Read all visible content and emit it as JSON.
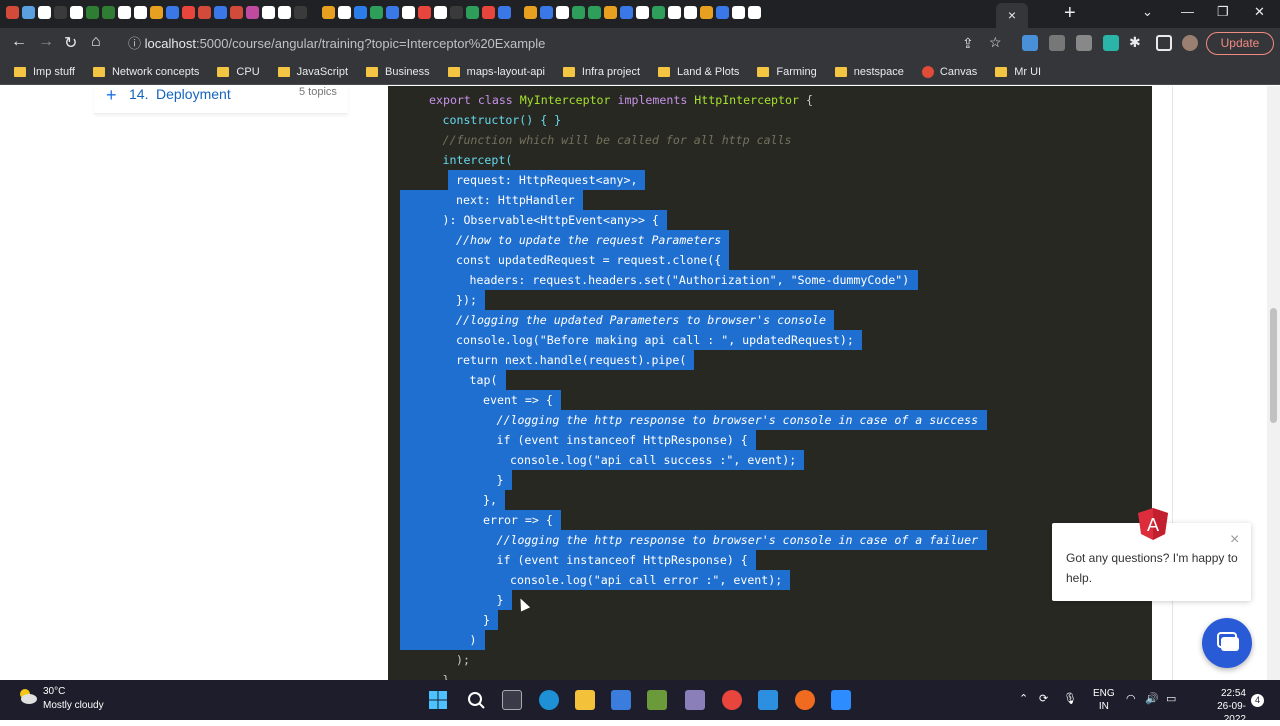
{
  "browser": {
    "url_host": "localhost",
    "url_rest": ":5000/course/angular/training?topic=Interceptor%20Example",
    "update_label": "Update",
    "bookmarks": [
      "Imp stuff",
      "Network concepts",
      "CPU",
      "JavaScript",
      "Business",
      "maps-layout-api",
      "Infra project",
      "Land & Plots",
      "Farming",
      "nestspace",
      "Canvas",
      "Mr UI"
    ]
  },
  "sidebar": {
    "item": {
      "icon": "+",
      "number": "14.",
      "title": "Deployment",
      "count": "5 topics"
    }
  },
  "code_lines": [
    {
      "indent": 0,
      "text": "export class MyInterceptor implements HttpInterceptor {",
      "kind": "class",
      "selected": false
    },
    {
      "indent": 1,
      "text": "constructor() { }",
      "kind": "fn",
      "selected": false
    },
    {
      "indent": 1,
      "text": "//function which will be called for all http calls",
      "kind": "comment",
      "selected": false
    },
    {
      "indent": 1,
      "text": "intercept(",
      "kind": "fn",
      "selected": false
    },
    {
      "indent": 2,
      "text": "request: HttpRequest<any>,",
      "kind": "plain",
      "selected": true
    },
    {
      "indent": 2,
      "text": "next: HttpHandler",
      "kind": "plain",
      "selected": true
    },
    {
      "indent": 1,
      "text": "): Observable<HttpEvent<any>> {",
      "kind": "plain",
      "selected": true
    },
    {
      "indent": 2,
      "text": "//how to update the request Parameters",
      "kind": "comment",
      "selected": true
    },
    {
      "indent": 2,
      "text": "const updatedRequest = request.clone({",
      "kind": "plain",
      "selected": true
    },
    {
      "indent": 3,
      "text": "headers: request.headers.set(\"Authorization\", \"Some-dummyCode\")",
      "kind": "plain",
      "selected": true
    },
    {
      "indent": 2,
      "text": "});",
      "kind": "plain",
      "selected": true
    },
    {
      "indent": 2,
      "text": "//logging the updated Parameters to browser's console",
      "kind": "comment",
      "selected": true
    },
    {
      "indent": 2,
      "text": "console.log(\"Before making api call : \", updatedRequest);",
      "kind": "plain",
      "selected": true
    },
    {
      "indent": 2,
      "text": "return next.handle(request).pipe(",
      "kind": "plain",
      "selected": true
    },
    {
      "indent": 3,
      "text": "tap(",
      "kind": "plain",
      "selected": true
    },
    {
      "indent": 4,
      "text": "event => {",
      "kind": "plain",
      "selected": true
    },
    {
      "indent": 5,
      "text": "//logging the http response to browser's console in case of a success",
      "kind": "comment",
      "selected": true
    },
    {
      "indent": 5,
      "text": "if (event instanceof HttpResponse) {",
      "kind": "plain",
      "selected": true
    },
    {
      "indent": 6,
      "text": "console.log(\"api call success :\", event);",
      "kind": "plain",
      "selected": true
    },
    {
      "indent": 5,
      "text": "}",
      "kind": "plain",
      "selected": true
    },
    {
      "indent": 4,
      "text": "},",
      "kind": "plain",
      "selected": true
    },
    {
      "indent": 4,
      "text": "error => {",
      "kind": "plain",
      "selected": true
    },
    {
      "indent": 5,
      "text": "//logging the http response to browser's console in case of a failuer",
      "kind": "comment",
      "selected": true
    },
    {
      "indent": 5,
      "text": "if (event instanceof HttpResponse) {",
      "kind": "plain",
      "selected": true
    },
    {
      "indent": 6,
      "text": "console.log(\"api call error :\", event);",
      "kind": "plain",
      "selected": true
    },
    {
      "indent": 5,
      "text": "}",
      "kind": "plain",
      "selected": true
    },
    {
      "indent": 4,
      "text": "}",
      "kind": "plain",
      "selected": true
    },
    {
      "indent": 3,
      "text": ")",
      "kind": "plain",
      "selected": true
    },
    {
      "indent": 2,
      "text": ");",
      "kind": "plain",
      "selected": false
    },
    {
      "indent": 1,
      "text": "}",
      "kind": "plain",
      "selected": false
    }
  ],
  "chat": {
    "message": "Got any questions? I'm happy to help.",
    "close_icon": "×"
  },
  "taskbar": {
    "temperature": "30°C",
    "weather": "Mostly cloudy",
    "lang_top": "ENG",
    "lang_bottom": "IN",
    "time": "22:54",
    "date": "26-09-2022",
    "notifications": "4"
  },
  "colors": {
    "code_bg": "#272822",
    "selection": "#1f6fd1",
    "accent_blue": "#1565c0",
    "taskbar_bg": "#1d1d2b"
  }
}
